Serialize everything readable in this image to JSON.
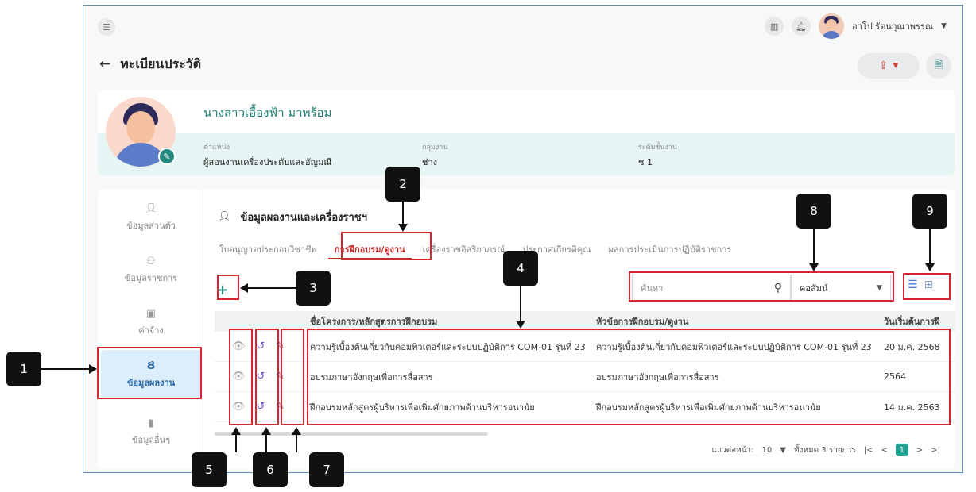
{
  "topbar": {
    "menu_icon": "menu-collapse-icon",
    "user_name": "อาโป รัตนกุณาพรรณ"
  },
  "header": {
    "title": "ทะเบียนประวัติ"
  },
  "profile": {
    "name": "นางสาวเอื้องฟ้า มาพร้อม",
    "position_label": "ตำแหน่ง",
    "position_value": "ผู้สอนงานเครื่องประดับและอัญมณี",
    "group_label": "กลุ่มงาน",
    "group_value": "ช่าง",
    "level_label": "ระดับชั้นงาน",
    "level_value": "ช 1"
  },
  "sidebar": {
    "items": [
      {
        "label": "ข้อมูลส่วนตัว",
        "icon": "person-icon"
      },
      {
        "label": "ข้อมูลราชการ",
        "icon": "org-chart-icon"
      },
      {
        "label": "ค่าจ้าง",
        "icon": "money-icon"
      },
      {
        "label": "ข้อมูลผลงาน",
        "icon": "medal-icon"
      },
      {
        "label": "ข้อมูลอื่นๆ",
        "icon": "bookmark-icon"
      }
    ]
  },
  "section": {
    "title": "ข้อมูลผลงานและเครื่องราชฯ"
  },
  "tabs": [
    "ใบอนุญาตประกอบวิชาชีพ",
    "การฝึกอบรม/ดูงาน",
    "เครื่องราชอิสริยาภรณ์",
    "ประกาศเกียรติคุณ",
    "ผลการประเมินการปฏิบัติราชการ"
  ],
  "toolbar": {
    "search_placeholder": "ค้นหา",
    "column_select": "คอลัมน์"
  },
  "table": {
    "headers": [
      "ชื่อโครงการ/หลักสูตรการฝึกอบรม",
      "หัวข้อการฝึกอบรม/ดูงาน",
      "วันเริ่มต้นการฝึ"
    ],
    "rows": [
      {
        "name": "ความรู้เบื้องต้นเกี่ยวกับคอมพิวเตอร์และระบบปฏิบัติการ COM-01 รุ่นที่ 23",
        "topic": "ความรู้เบื้องต้นเกี่ยวกับคอมพิวเตอร์และระบบปฏิบัติการ COM-01 รุ่นที่ 23",
        "date": "20 ม.ค. 2568"
      },
      {
        "name": "อบรมภาษาอังกฤษเพื่อการสื่อสาร",
        "topic": "อบรมภาษาอังกฤษเพื่อการสื่อสาร",
        "date": "2564"
      },
      {
        "name": "ฝึกอบรมหลักสูตรผู้บริหารเพื่อเพิ่มศักยภาพด้านบริหารอนามัย",
        "topic": "ฝึกอบรมหลักสูตรผู้บริหารเพื่อเพิ่มศักยภาพด้านบริหารอนามัย",
        "date": "14 ม.ค. 2563"
      }
    ]
  },
  "pagination": {
    "rows_label": "แถวต่อหน้า:",
    "rows_value": "10",
    "total_text": "ทั้งหมด 3 รายการ",
    "current_page": "1"
  },
  "callouts": [
    "1",
    "2",
    "3",
    "4",
    "5",
    "6",
    "7",
    "8",
    "9"
  ],
  "colors": {
    "accent": "#23897f",
    "highlight": "#d72631",
    "active_side": "#dceefb"
  }
}
